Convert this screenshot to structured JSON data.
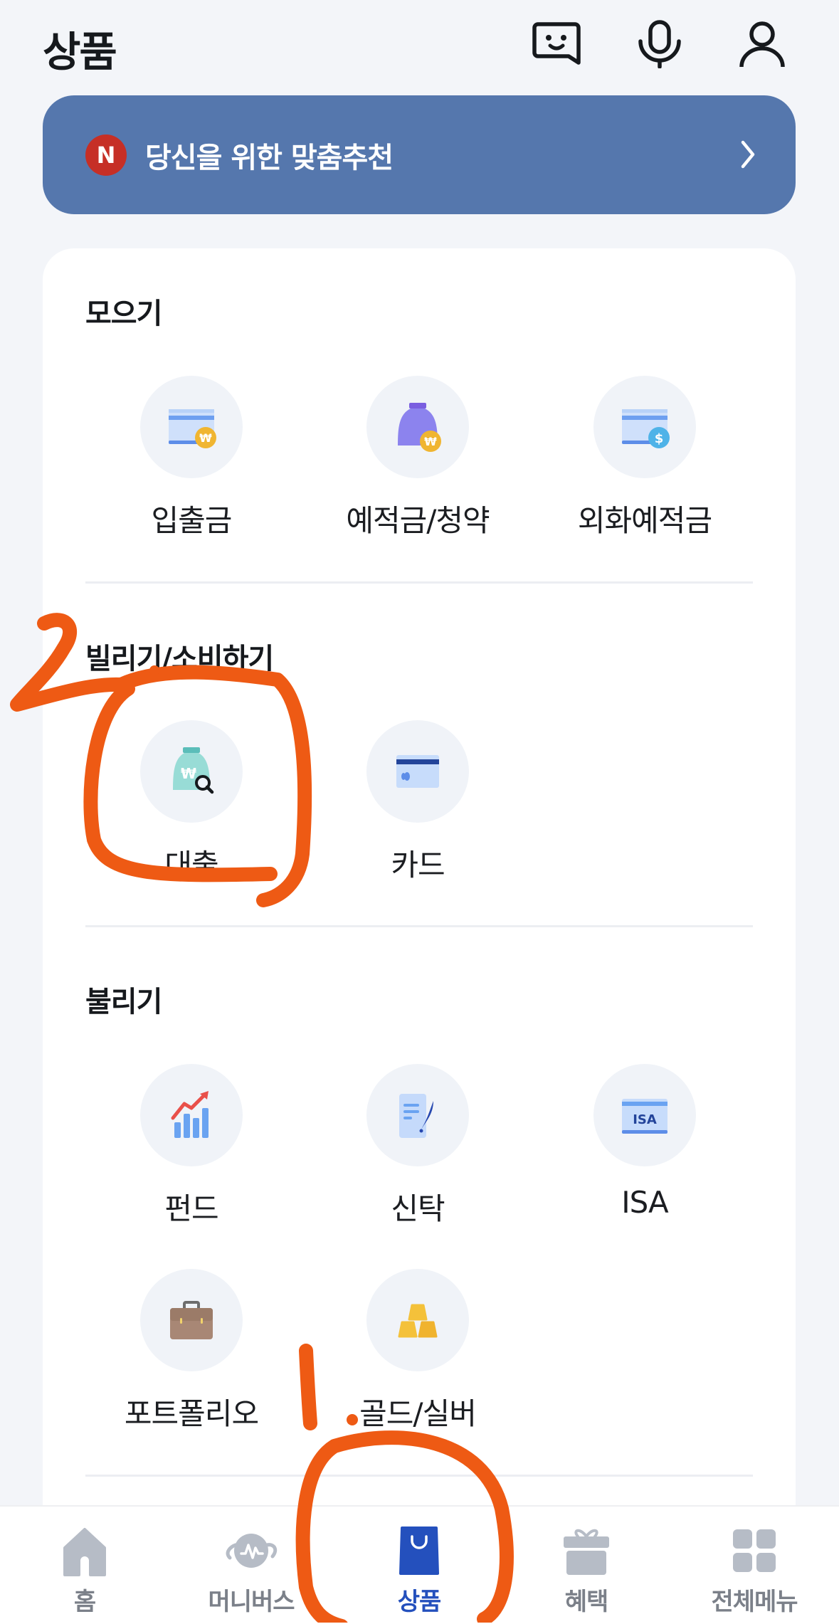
{
  "header": {
    "title": "상품",
    "icons": [
      "chatbot-icon",
      "microphone-icon",
      "profile-icon"
    ]
  },
  "banner": {
    "badge": "N",
    "text": "당신을 위한 맞춤추천",
    "colors": {
      "background": "#5577ad",
      "badge": "#c62f26"
    }
  },
  "sections": [
    {
      "title": "모으기",
      "items": [
        {
          "label": "입출금",
          "icon": "deposit-card-won-icon"
        },
        {
          "label": "예적금/청약",
          "icon": "savings-bag-won-icon"
        },
        {
          "label": "외화예적금",
          "icon": "foreign-currency-card-dollar-icon"
        }
      ]
    },
    {
      "title": "빌리기/소비하기",
      "items": [
        {
          "label": "대출",
          "icon": "loan-bag-search-icon"
        },
        {
          "label": "카드",
          "icon": "credit-card-icon"
        }
      ]
    },
    {
      "title": "불리기",
      "items": [
        {
          "label": "펀드",
          "icon": "fund-chart-icon"
        },
        {
          "label": "신탁",
          "icon": "trust-document-icon"
        },
        {
          "label": "ISA",
          "icon": "isa-card-icon",
          "icon_text": "ISA"
        },
        {
          "label": "포트폴리오",
          "icon": "briefcase-icon"
        },
        {
          "label": "골드/실버",
          "icon": "gold-bars-icon"
        }
      ]
    }
  ],
  "bottom_nav": {
    "items": [
      {
        "label": "홈",
        "icon": "home-icon",
        "active": false
      },
      {
        "label": "머니버스",
        "icon": "moneyverse-planet-icon",
        "active": false
      },
      {
        "label": "상품",
        "icon": "shopping-bag-icon",
        "active": true
      },
      {
        "label": "혜택",
        "icon": "gift-icon",
        "active": false
      },
      {
        "label": "전체메뉴",
        "icon": "grid-menu-icon",
        "active": false
      }
    ],
    "colors": {
      "active": "#2450bd",
      "inactive": "#b6bcc6"
    }
  },
  "annotations": {
    "color": "#ee5a14",
    "marks": [
      "1",
      "2"
    ]
  }
}
